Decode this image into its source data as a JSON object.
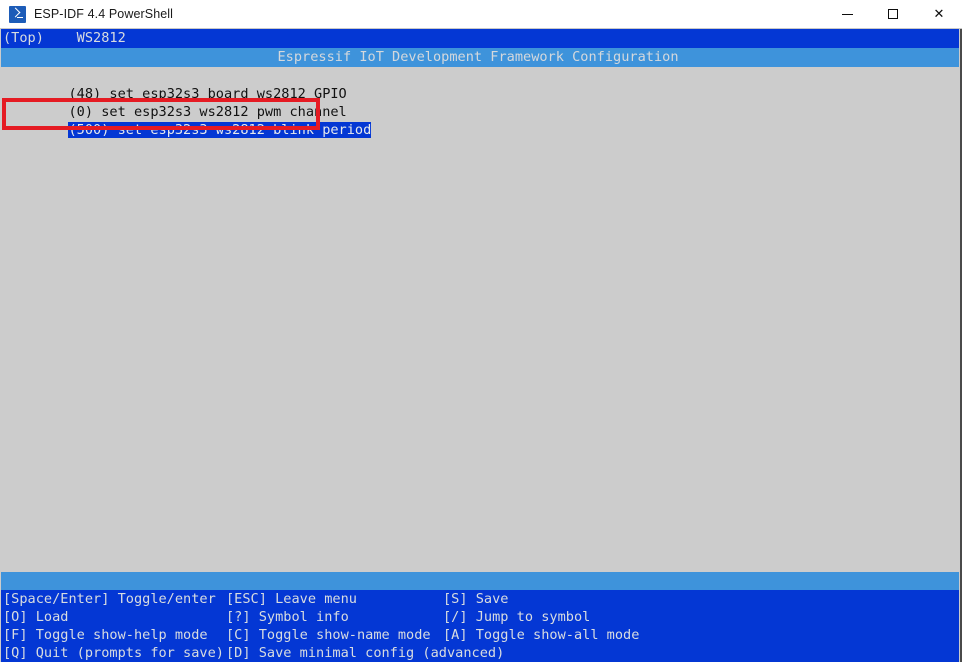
{
  "window": {
    "title": "ESP-IDF 4.4 PowerShell",
    "icon": "powershell-icon",
    "controls": {
      "minimize": "—",
      "maximize": "☐",
      "close": "✕"
    }
  },
  "colors": {
    "menu_blue": "#0437d4",
    "header_blue": "#3e93db",
    "terminal_bg": "#cccccc",
    "annotation_red": "#e51b23",
    "text_light": "#d8dce0",
    "text_dark": "#111111"
  },
  "terminal": {
    "breadcrumb": "(Top)    WS2812",
    "app_title": "Espressif IoT Development Framework Configuration",
    "menu_items": [
      {
        "text": "(48) set esp32s3 board ws2812 GPIO",
        "value": "48",
        "label": "set esp32s3 board ws2812 GPIO",
        "selected": false
      },
      {
        "text": "(0) set esp32s3 ws2812 pwm channel",
        "value": "0",
        "label": "set esp32s3 ws2812 pwm channel",
        "selected": false
      },
      {
        "text": "(500) set esp32s3 ws2812 blink period",
        "value": "500",
        "label": "set esp32s3 ws2812 blink period",
        "selected": true
      }
    ],
    "annotation": {
      "type": "red-rectangle",
      "targets": "set esp32s3 ws2812 blink period"
    }
  },
  "help": {
    "rows": [
      {
        "col1": "[Space/Enter] Toggle/enter",
        "col2": "[ESC] Leave menu",
        "col3": "[S] Save"
      },
      {
        "col1": "[O] Load",
        "col2": "[?] Symbol info",
        "col3": "[/] Jump to symbol"
      },
      {
        "col1": "[F] Toggle show-help mode",
        "col2": "[C] Toggle show-name mode",
        "col3": "[A] Toggle show-all mode"
      },
      {
        "col1": "[Q] Quit (prompts for save)",
        "col2": "[D] Save minimal config (advanced)",
        "col3": ""
      }
    ]
  }
}
